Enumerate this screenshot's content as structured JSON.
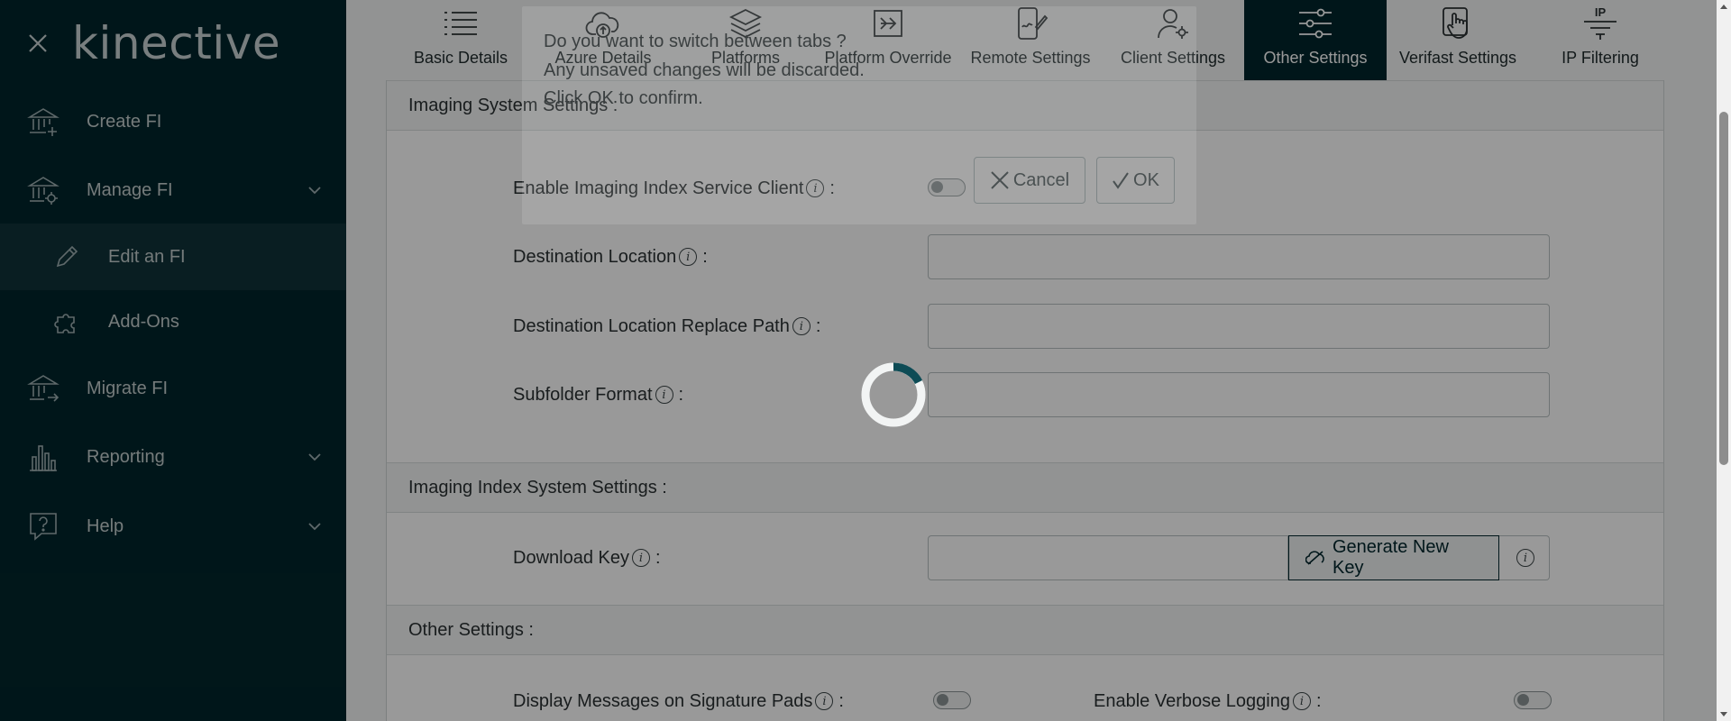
{
  "sidebar": {
    "logo_text": "kinective",
    "close_icon": "close-icon",
    "items": [
      {
        "label": "Create FI",
        "icon": "bank-plus-icon"
      },
      {
        "label": "Manage FI",
        "icon": "bank-gear-icon",
        "has_chevron": true
      },
      {
        "label": "Edit an FI",
        "icon": "pencil-icon",
        "active": true
      },
      {
        "label": "Add-Ons",
        "icon": "puzzle-icon"
      },
      {
        "label": "Migrate FI",
        "icon": "bank-arrow-icon"
      },
      {
        "label": "Reporting",
        "icon": "bar-chart-icon",
        "has_chevron": true
      },
      {
        "label": "Help",
        "icon": "help-bubble-icon",
        "has_chevron": true
      }
    ]
  },
  "tabs": [
    {
      "label": "Basic Details",
      "icon": "list-icon"
    },
    {
      "label": "Azure Details",
      "icon": "cloud-upload-icon"
    },
    {
      "label": "Platforms",
      "icon": "layers-icon"
    },
    {
      "label": "Platform Override",
      "icon": "arrow-box-icon"
    },
    {
      "label": "Remote Settings",
      "icon": "phone-sign-icon"
    },
    {
      "label": "Client Settings",
      "icon": "user-gear-icon"
    },
    {
      "label": "Other Settings",
      "icon": "sliders-icon",
      "active": true
    },
    {
      "label": "Verifast Settings",
      "icon": "hand-touch-icon"
    },
    {
      "label": "IP Filtering",
      "icon": "ip-filter-icon",
      "icon_text": "IP"
    }
  ],
  "sections": {
    "imaging": {
      "title": "Imaging System Settings :",
      "enable_label": "Enable Imaging Index Service Client",
      "destination_label": "Destination Location",
      "destination_value": "",
      "replace_path_label": "Destination Location Replace Path",
      "replace_path_value": "",
      "subfolder_label": "Subfolder Format",
      "subfolder_value": ""
    },
    "index": {
      "title": "Imaging Index System Settings :",
      "download_key_label": "Download Key",
      "download_key_value": "",
      "generate_button": "Generate New Key"
    },
    "other": {
      "title": "Other Settings :",
      "signature_pads_label": "Display Messages on Signature Pads",
      "verbose_logging_label": "Enable Verbose Logging"
    }
  },
  "dialog": {
    "line1": "Do you want to switch between tabs ?",
    "line2": "Any unsaved changes will be discarded.",
    "line3": "Click OK to confirm.",
    "cancel_label": "Cancel",
    "ok_label": "OK"
  },
  "colors": {
    "sidebar_bg": "#01262c",
    "active_tab_bg": "#01262c",
    "spinner_accent": "#0d4b55"
  }
}
